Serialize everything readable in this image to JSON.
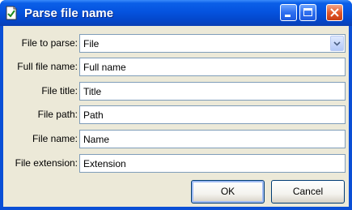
{
  "window": {
    "title": "Parse file name",
    "icon": "document-check-icon"
  },
  "form": {
    "file_to_parse": {
      "label": "File to parse:",
      "value": "File"
    },
    "full_file_name": {
      "label": "Full file name:",
      "value": "Full name"
    },
    "file_title": {
      "label": "File title:",
      "value": "Title"
    },
    "file_path": {
      "label": "File path:",
      "value": "Path"
    },
    "file_name": {
      "label": "File name:",
      "value": "Name"
    },
    "file_extension": {
      "label": "File extension:",
      "value": "Extension"
    }
  },
  "buttons": {
    "ok": "OK",
    "cancel": "Cancel"
  },
  "colors": {
    "titlebar": "#0553df",
    "dialog_bg": "#ece9d8",
    "field_border": "#7f9db9",
    "close_button": "#e35a2c"
  }
}
